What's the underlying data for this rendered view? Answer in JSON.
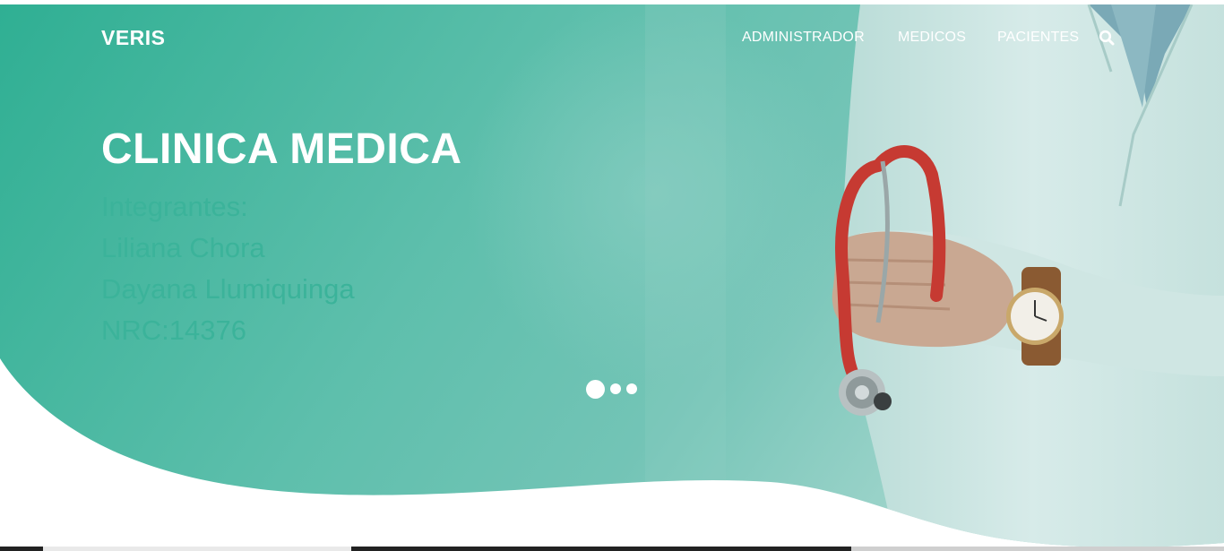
{
  "navbar": {
    "brand": "VERIS",
    "items": [
      {
        "label": "ADMINISTRADOR"
      },
      {
        "label": "MEDICOS"
      },
      {
        "label": "PACIENTES"
      }
    ],
    "search_icon": "search-icon"
  },
  "hero": {
    "title": "CLINICA MEDICA",
    "lines": [
      "Integrantes:",
      "Liliana Chora",
      "Dayana Llumiquinga",
      "NRC:14376"
    ],
    "slides_count": 3,
    "active_slide": 1
  },
  "colors": {
    "teal_primary": "#3bb39a",
    "teal_light": "#7cc9bb",
    "white": "#ffffff",
    "coat": "#dcecea",
    "stethoscope_red": "#c63a32"
  }
}
